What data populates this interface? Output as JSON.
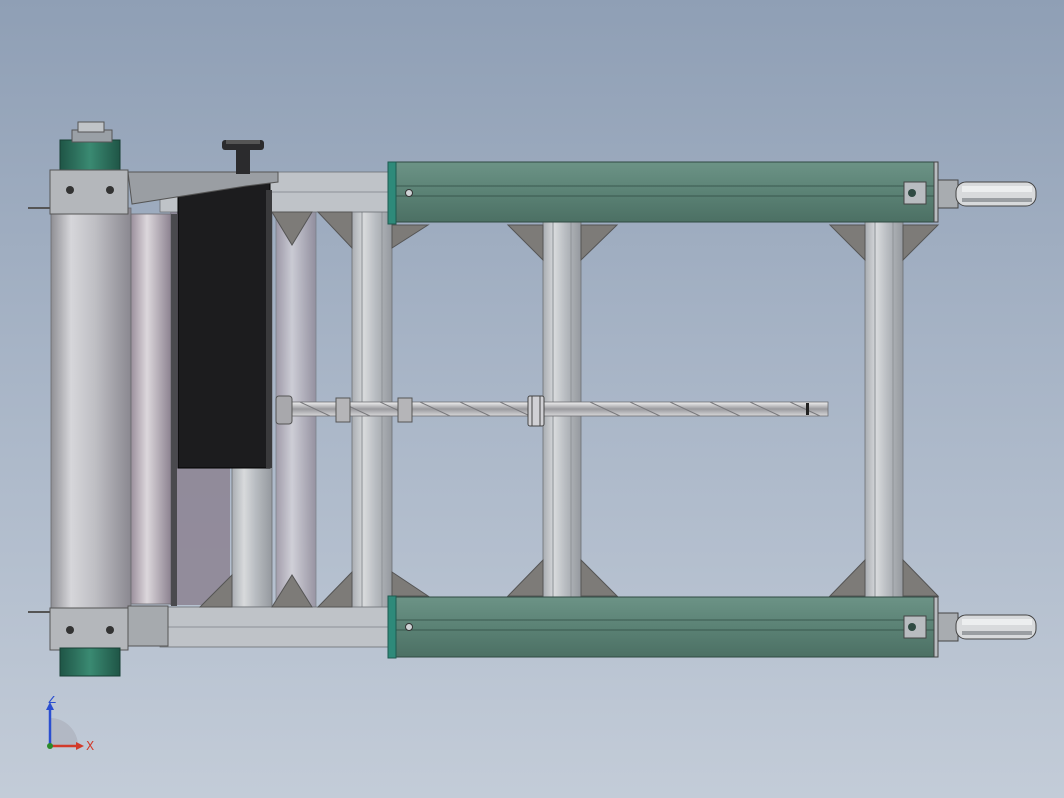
{
  "viewport": {
    "triad": {
      "z_label": "Z",
      "x_label": "X"
    },
    "colors": {
      "background_top": "#8f9fb5",
      "background_bottom": "#c3ccd8",
      "aluminum": "#c9ccd0",
      "aluminum_dark": "#8e9297",
      "motor_green": "#2e6b5a",
      "rail_teal": "#5f8579",
      "dark_panel": "#1c1c1e",
      "roller_gray": "#bfbfc2",
      "gusset": "#7d7b78",
      "axis_x": "#d23a2a",
      "axis_y": "#2a8a2a",
      "axis_z": "#2a4ed0"
    }
  }
}
